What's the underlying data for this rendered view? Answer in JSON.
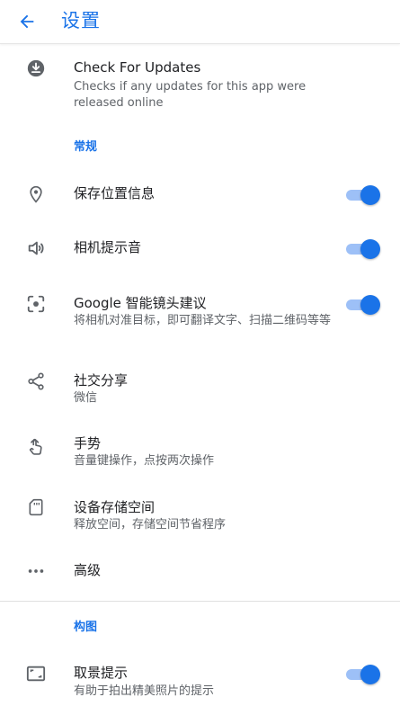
{
  "appbar": {
    "title": "设置",
    "back_icon": "arrow-back-icon"
  },
  "colors": {
    "accent": "#1a73e8",
    "toggle_track": "#9dc0f7",
    "notification_dot": "#ff6d3a"
  },
  "update": {
    "icon": "download-icon",
    "title": "Check For Updates",
    "subtitle": "Checks if any updates for this app were released online"
  },
  "sections": {
    "general": "常规",
    "composition": "构图"
  },
  "settings": {
    "save_location": {
      "icon": "location-pin-icon",
      "title": "保存位置信息",
      "enabled": true
    },
    "camera_sound": {
      "icon": "speaker-icon",
      "title": "相机提示音",
      "enabled": true
    },
    "google_lens": {
      "icon": "lens-icon",
      "title": "Google 智能镜头建议",
      "subtitle": "将相机对准目标，即可翻译文字、扫描二维码等等",
      "enabled": true
    },
    "social_share": {
      "icon": "share-icon",
      "title": "社交分享",
      "subtitle": "微信"
    },
    "gestures": {
      "icon": "gesture-hand-icon",
      "title": "手势",
      "subtitle": "音量键操作，点按两次操作"
    },
    "storage": {
      "icon": "sd-card-icon",
      "title": "设备存储空间",
      "subtitle": "释放空间，存储空间节省程序"
    },
    "advanced": {
      "icon": "more-dots-icon",
      "title": "高级"
    },
    "framing_hints": {
      "icon": "framing-icon",
      "title": "取景提示",
      "subtitle": "有助于拍出精美照片的提示",
      "enabled": true
    }
  }
}
